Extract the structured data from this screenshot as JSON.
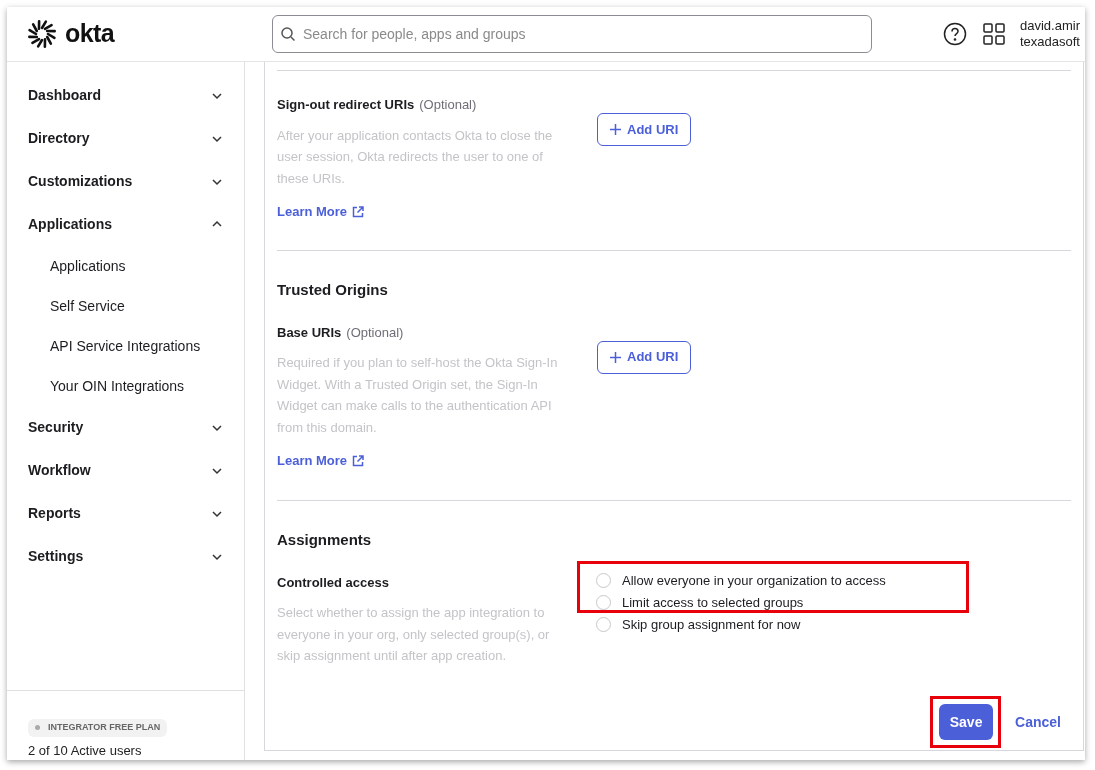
{
  "header": {
    "logo": "okta",
    "search": {
      "placeholder": "Search for people, apps and groups"
    },
    "user": {
      "name": "david.amir",
      "org": "texadasoft"
    }
  },
  "sidebar": {
    "items": [
      {
        "label": "Dashboard",
        "expanded": false
      },
      {
        "label": "Directory",
        "expanded": false
      },
      {
        "label": "Customizations",
        "expanded": false
      },
      {
        "label": "Applications",
        "expanded": true,
        "children": [
          {
            "label": "Applications"
          },
          {
            "label": "Self Service"
          },
          {
            "label": "API Service Integrations"
          },
          {
            "label": "Your OIN Integrations"
          }
        ]
      },
      {
        "label": "Security",
        "expanded": false
      },
      {
        "label": "Workflow",
        "expanded": false
      },
      {
        "label": "Reports",
        "expanded": false
      },
      {
        "label": "Settings",
        "expanded": false
      }
    ],
    "plan_badge": "INTEGRATOR FREE PLAN",
    "users": "2 of 10 Active users"
  },
  "sections": [
    {
      "fields": [
        {
          "label": "Sign-out redirect URIs",
          "optional": "(Optional)",
          "description": "After your application contacts Okta to close the user session, Okta redirects the user to one of these URIs.",
          "link": "Learn More",
          "button": "Add URI"
        }
      ]
    },
    {
      "title": "Trusted Origins",
      "fields": [
        {
          "label": "Base URIs",
          "optional": "(Optional)",
          "description": "Required if you plan to self-host the Okta Sign-In Widget. With a Trusted Origin set, the Sign-In Widget can make calls to the authentication API from this domain.",
          "link": "Learn More",
          "button": "Add URI"
        }
      ]
    },
    {
      "title": "Assignments",
      "fields": [
        {
          "label": "Controlled access",
          "description": "Select whether to assign the app integration to everyone in your org, only selected group(s), or skip assignment until after app creation.",
          "options": [
            {
              "label": "Allow everyone in your organization to access",
              "selected": false
            },
            {
              "label": "Limit access to selected groups",
              "selected": false
            },
            {
              "label": "Skip group assignment for now",
              "selected": false
            }
          ]
        }
      ]
    }
  ],
  "actions": {
    "save": "Save",
    "cancel": "Cancel"
  }
}
